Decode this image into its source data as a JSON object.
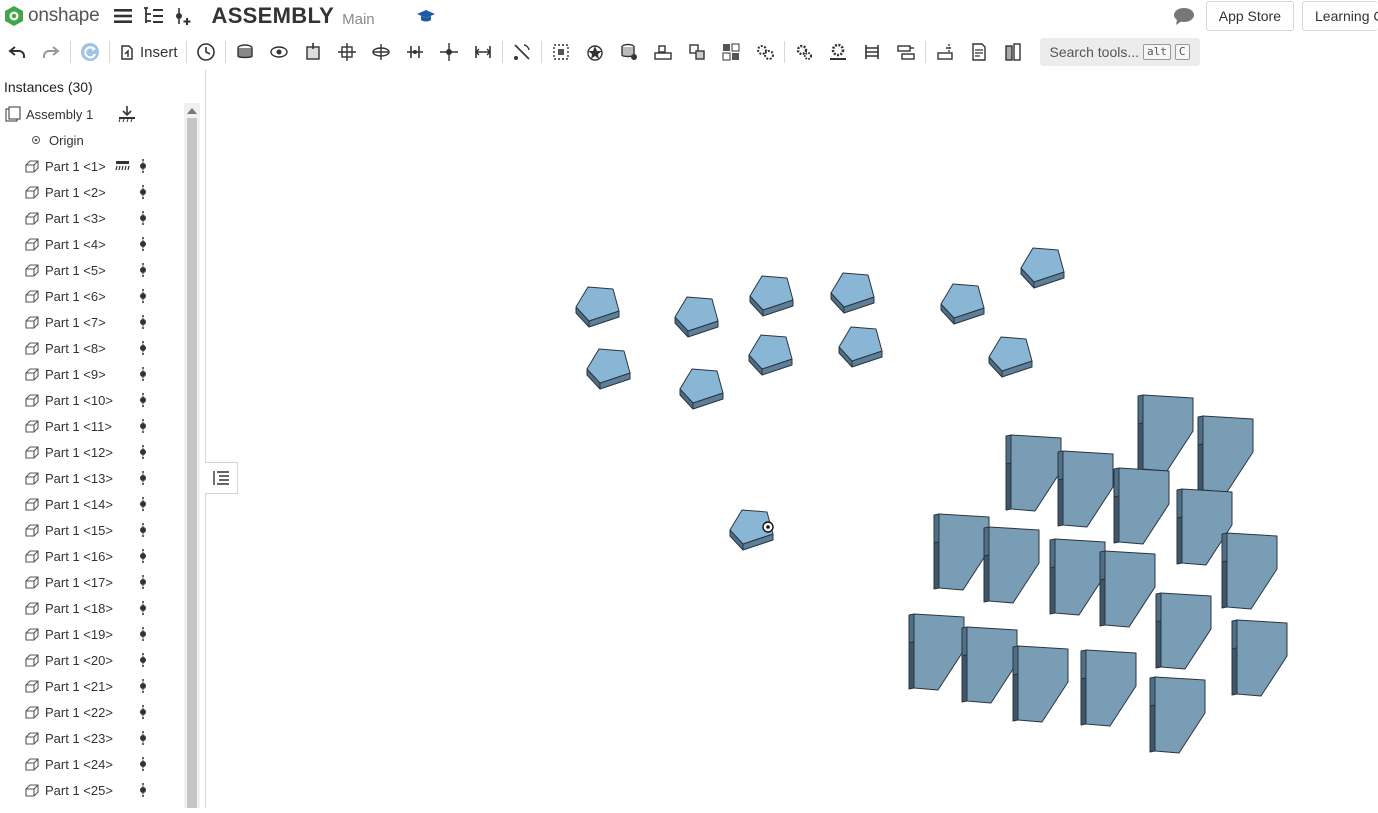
{
  "app": {
    "logo_text": "onshape"
  },
  "document": {
    "title": "ASSEMBLY",
    "branch": "Main"
  },
  "top_right": {
    "app_store": "App Store",
    "learning": "Learning C"
  },
  "toolbar": {
    "insert_label": "Insert",
    "search_label": "Search tools...",
    "shortcut_mod": "alt",
    "shortcut_key": "C"
  },
  "sidebar": {
    "header": "Instances (30)",
    "assembly": "Assembly 1",
    "origin": "Origin",
    "parts": [
      "Part 1 <1>",
      "Part 1 <2>",
      "Part 1 <3>",
      "Part 1 <4>",
      "Part 1 <5>",
      "Part 1 <6>",
      "Part 1 <7>",
      "Part 1 <8>",
      "Part 1 <9>",
      "Part 1 <10>",
      "Part 1 <11>",
      "Part 1 <12>",
      "Part 1 <13>",
      "Part 1 <14>",
      "Part 1 <15>",
      "Part 1 <16>",
      "Part 1 <17>",
      "Part 1 <18>",
      "Part 1 <19>",
      "Part 1 <20>",
      "Part 1 <21>",
      "Part 1 <22>",
      "Part 1 <23>",
      "Part 1 <24>",
      "Part 1 <25>"
    ]
  },
  "colors": {
    "part_face": "#8ab6d6",
    "part_side": "#4f6f86",
    "part_edge": "#2a3540",
    "accent_blue": "#1f5aa6"
  }
}
